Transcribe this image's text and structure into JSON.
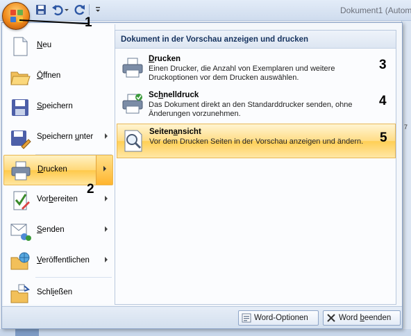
{
  "window": {
    "title": "Dokument1 (Autom"
  },
  "quick_access": [
    "save-icon",
    "undo-icon",
    "redo-icon",
    "customize-icon"
  ],
  "callouts": {
    "one": "1",
    "two": "2"
  },
  "menu": {
    "items": [
      {
        "label_pre": "",
        "label_key": "N",
        "label_post": "eu",
        "icon": "new-document-icon",
        "arrow": false
      },
      {
        "label_pre": "",
        "label_key": "Ö",
        "label_post": "ffnen",
        "icon": "open-folder-icon",
        "arrow": false
      },
      {
        "label_pre": "",
        "label_key": "S",
        "label_post": "peichern",
        "icon": "save-icon",
        "arrow": false
      },
      {
        "label_pre": "Speichern ",
        "label_key": "u",
        "label_post": "nter",
        "icon": "save-as-icon",
        "arrow": true
      },
      {
        "label_pre": "",
        "label_key": "D",
        "label_post": "rucken",
        "icon": "printer-icon",
        "arrow": true,
        "active": true
      },
      {
        "label_pre": "Vor",
        "label_key": "b",
        "label_post": "ereiten",
        "icon": "prepare-icon",
        "arrow": true
      },
      {
        "label_pre": "",
        "label_key": "S",
        "label_post": "enden",
        "icon": "send-icon",
        "arrow": true
      },
      {
        "label_pre": "",
        "label_key": "V",
        "label_post": "eröffentlichen",
        "icon": "publish-icon",
        "arrow": true
      },
      {
        "label_pre": "Schl",
        "label_key": "i",
        "label_post": "eßen",
        "icon": "close-document-icon",
        "arrow": false
      }
    ]
  },
  "submenu": {
    "header": "Dokument in der Vorschau anzeigen und drucken",
    "items": [
      {
        "title_key": "D",
        "title_post": "rucken",
        "title_pre": "",
        "desc": "Einen Drucker, die Anzahl von Exemplaren und weitere Druckoptionen vor dem Drucken auswählen.",
        "number": "3"
      },
      {
        "title_pre": "Sc",
        "title_key": "h",
        "title_post": "nelldruck",
        "desc": "Das Dokument direkt an den Standarddrucker senden, ohne Änderungen vorzunehmen.",
        "number": "4"
      },
      {
        "title_pre": "Seiten",
        "title_key": "a",
        "title_post": "nsicht",
        "desc": "Vor dem Drucken Seiten in der Vorschau anzeigen und ändern.",
        "number": "5",
        "active": true
      }
    ]
  },
  "footer": {
    "options_label": "Word-Optionen",
    "exit_pre": "Word ",
    "exit_key": "b",
    "exit_post": "eenden"
  },
  "ruler_tick": "7",
  "colors": {
    "accent": "#ffc94a",
    "office_button": "#f08a1a",
    "header_text": "#15325e"
  }
}
